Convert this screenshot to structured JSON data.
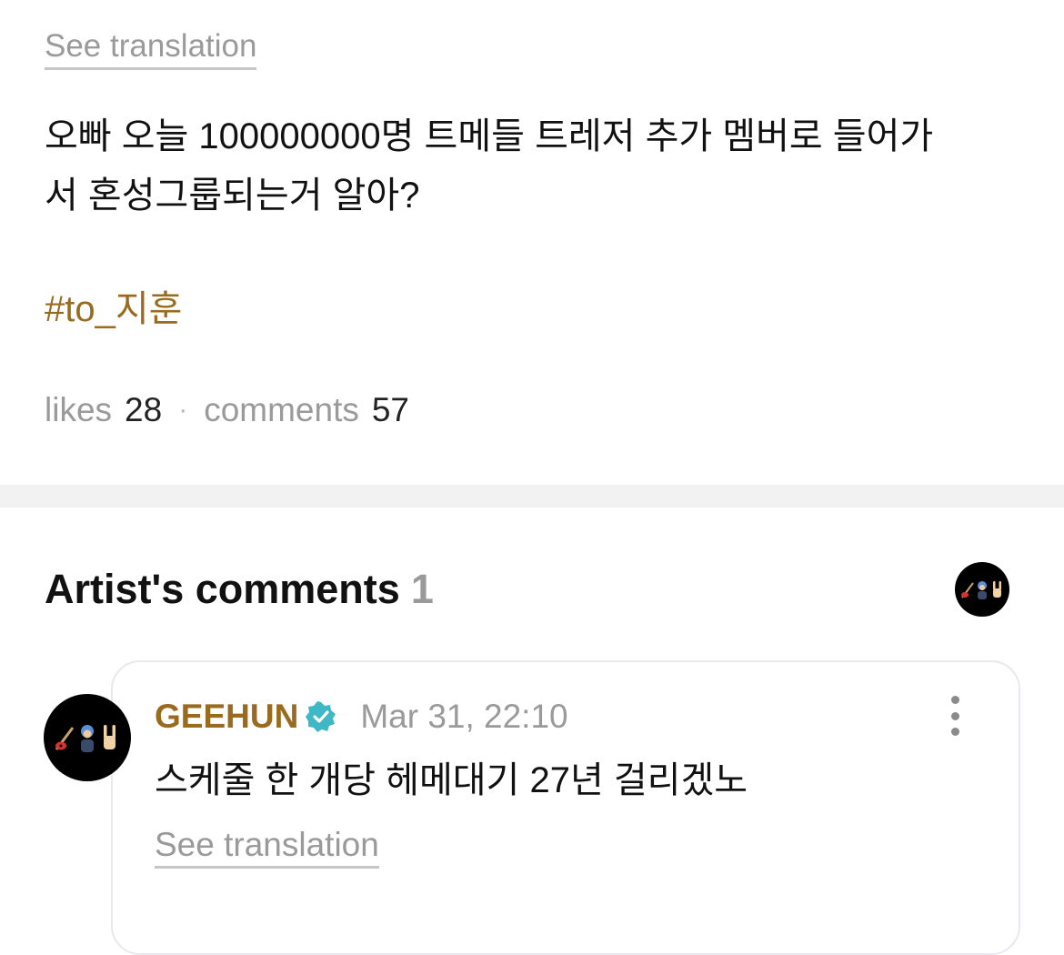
{
  "post": {
    "see_translation": "See translation",
    "body": "오빠 오늘 100000000명 트메들 트레저 추가 멤버로 들어가\n서 혼성그룹되는거 알아?",
    "hashtag": "#to_지훈",
    "likes_label": "likes",
    "likes_count": "28",
    "separator": "·",
    "comments_label": "comments",
    "comments_count": "57"
  },
  "artist_comments": {
    "title": "Artist's comments",
    "count": "1",
    "comments": [
      {
        "author": "GEEHUN",
        "verified": true,
        "timestamp": "Mar 31, 22:10",
        "text": "스케줄 한 개당 헤메대기 27년 걸리겠노",
        "see_translation": "See translation"
      }
    ]
  },
  "colors": {
    "accent": "#9a6b1e",
    "muted": "#9a9a9a",
    "verified": "#3fb7c4",
    "divider": "#f2f2f2"
  },
  "icons": {
    "header_avatar": "guitar-person-rock-hand-avatar",
    "verified": "verified-badge-icon",
    "more": "more-vertical-icon"
  }
}
